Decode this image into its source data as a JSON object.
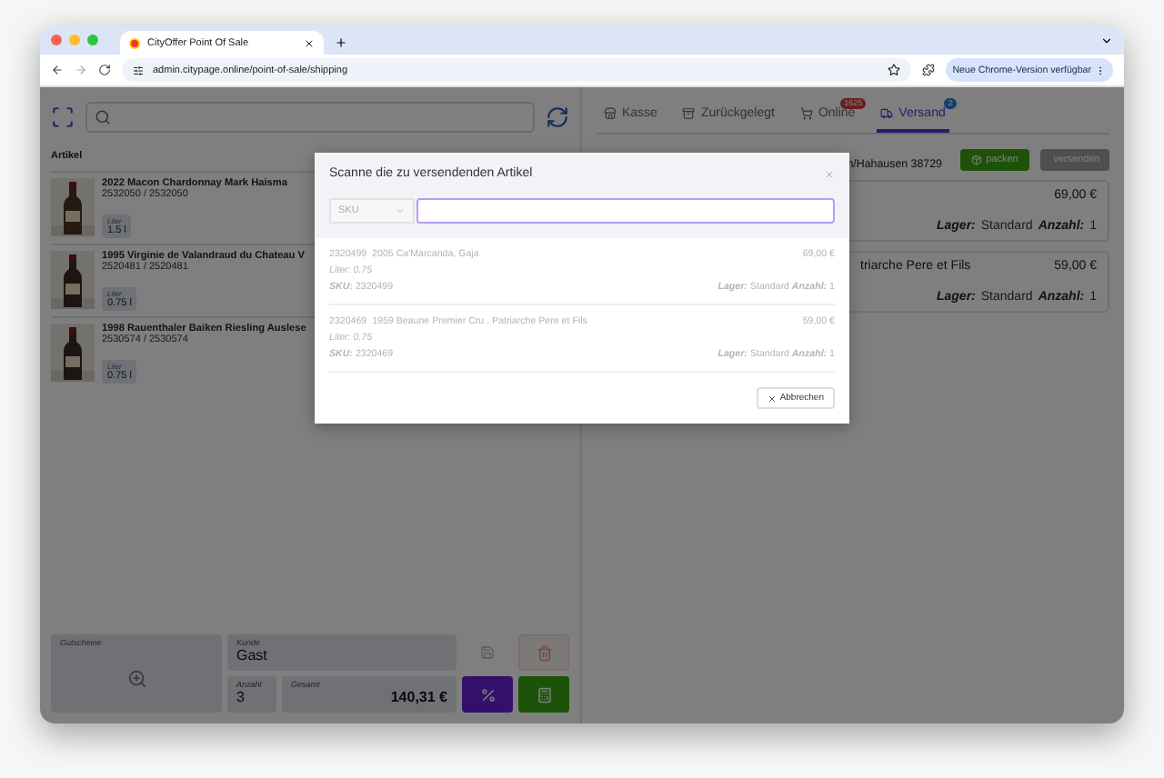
{
  "browser": {
    "tab_title": "CityOffer Point Of Sale",
    "url": "admin.citypage.online/point-of-sale/shipping",
    "update_button": "Neue Chrome-Version verfügbar"
  },
  "left": {
    "articles_label": "Artikel",
    "items": [
      {
        "name": "2022 Macon Chardonnay Mark Haisma",
        "ids": "2532050 / 2532050",
        "volume_label": "Liter",
        "volume": "1.5 l"
      },
      {
        "name": "1995 Virginie de Valandraud du Chateau V",
        "ids": "2520481 / 2520481",
        "volume_label": "Liter",
        "volume": "0.75 l"
      },
      {
        "name": "1998 Rauenthaler Baiken Riesling Auslese",
        "ids": "2530574 / 2530574",
        "volume_label": "Liter",
        "volume": "0.75 l"
      }
    ],
    "footer": {
      "vouchers_label": "Gutscheine",
      "customer_label": "Kunde",
      "customer": "Gast",
      "count_label": "Anzahl",
      "count": "3",
      "total_label": "Gesamt",
      "total": "140,31 €",
      "buttons": [
        {
          "kind": "save",
          "disabled": true
        },
        {
          "kind": "delete",
          "disabled": true
        },
        {
          "kind": "discount",
          "disabled": false
        },
        {
          "kind": "checkout",
          "disabled": false
        }
      ]
    }
  },
  "right": {
    "tabs": [
      {
        "kind": "store",
        "label": "Kasse",
        "selected": false
      },
      {
        "kind": "archive",
        "label": "Zurückgelegt",
        "selected": false
      },
      {
        "kind": "cart",
        "label": "Online",
        "badge": "1625",
        "selected": false
      },
      {
        "kind": "truck",
        "label": "Versand",
        "badge": "2",
        "selected": true
      }
    ],
    "address": "n/Hahausen 38729",
    "actions": [
      {
        "kind": "pack",
        "label": "packen",
        "disabled": false
      },
      {
        "kind": "send",
        "label": "versenden",
        "disabled": true
      }
    ],
    "orders": [
      {
        "price": "69,00 €",
        "stock_label": "Lager:",
        "stock": "Standard",
        "qty_label": "Anzahl:",
        "qty": "1"
      },
      {
        "name": "triarche Pere et Fils",
        "price": "59,00 €",
        "stock_label": "Lager:",
        "stock": "Standard",
        "qty_label": "Anzahl:",
        "qty": "1"
      }
    ]
  },
  "dialog": {
    "title": "Scanne die zu versendenden Artikel",
    "select": "SKU",
    "items": [
      {
        "code": "2320499",
        "name": "2005 Ca'Marcanda, Gaja",
        "liter": "Liter: 0.75",
        "sku_label": "SKU:",
        "sku": "2320499",
        "price": "69,00 €",
        "stock_label": "Lager:",
        "stock": "Standard",
        "qty_label": "Anzahl:",
        "qty": "1"
      },
      {
        "code": "2320469",
        "name": "1959 Beaune Premier Cru , Patriarche Pere et Fils",
        "liter": "Liter: 0.75",
        "sku_label": "SKU:",
        "sku": "2320469",
        "price": "59,00 €",
        "stock_label": "Lager:",
        "stock": "Standard",
        "qty_label": "Anzahl:",
        "qty": "1"
      }
    ],
    "cancel": "Abbrechen"
  }
}
